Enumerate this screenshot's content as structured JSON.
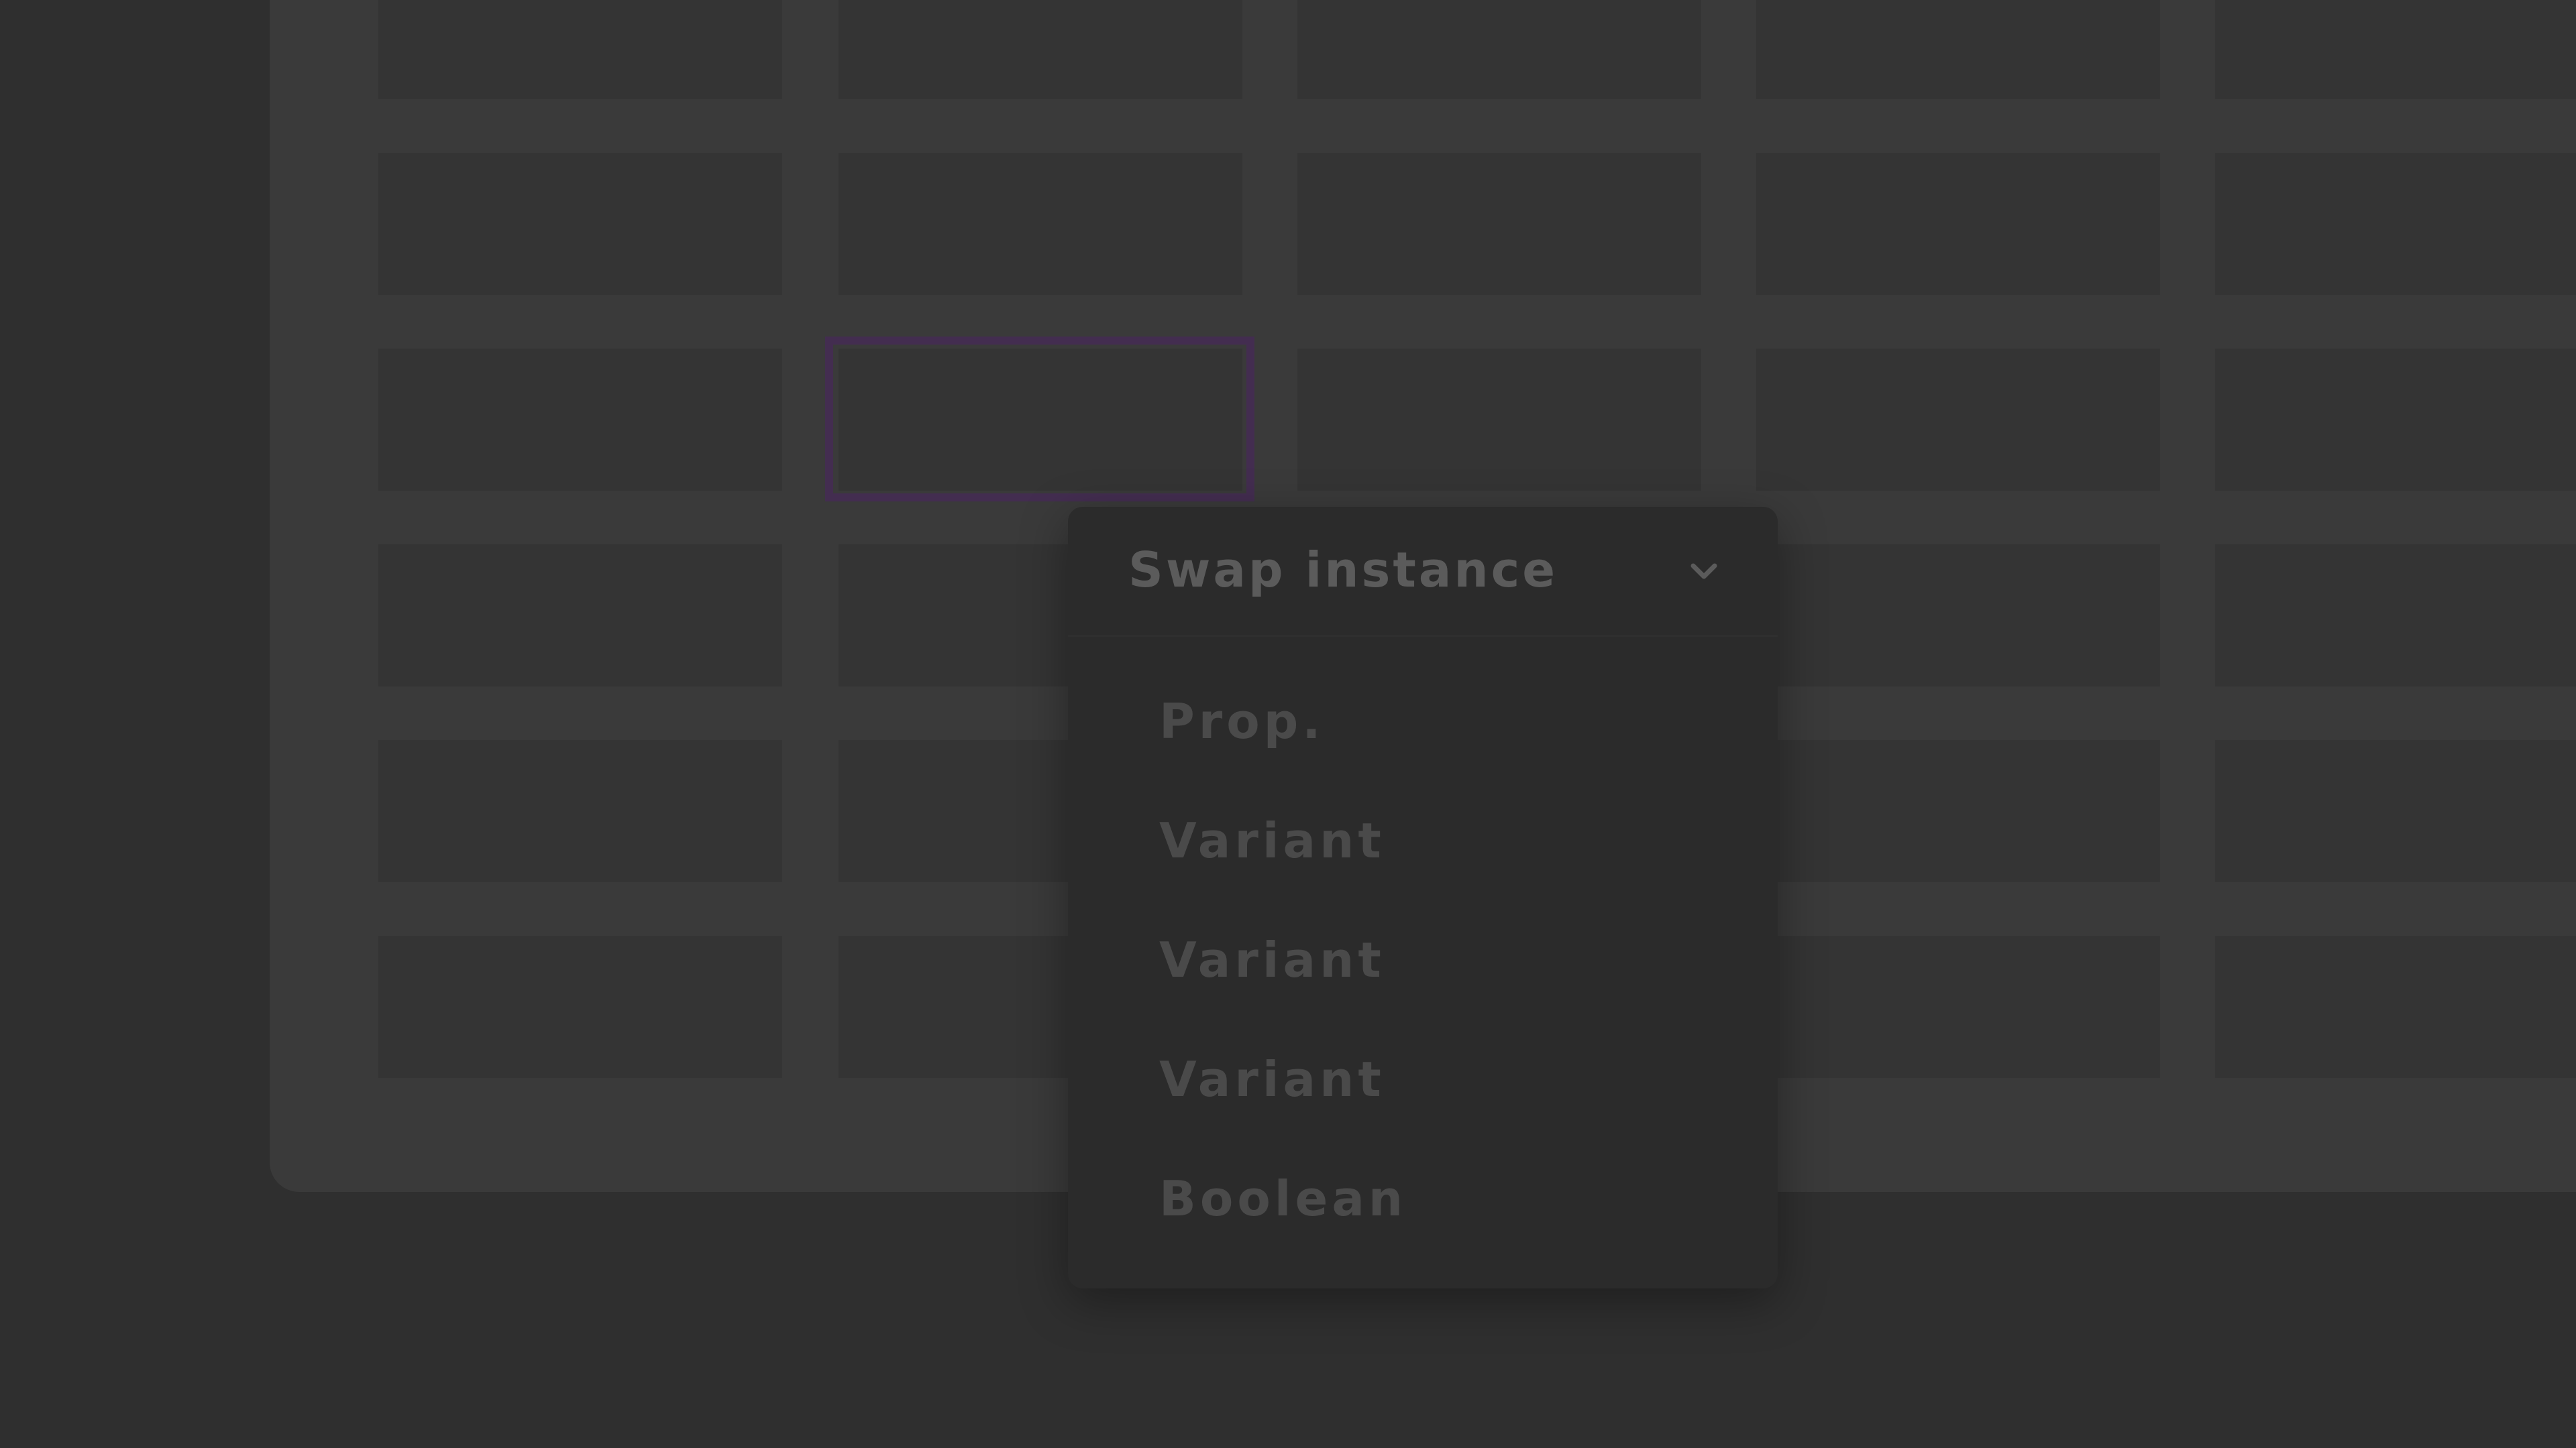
{
  "dropdown": {
    "title": "Swap instance",
    "toggle_icon": "chevron-down-icon",
    "items": [
      {
        "label": "Prop."
      },
      {
        "label": "Variant"
      },
      {
        "label": "Variant"
      },
      {
        "label": "Variant"
      },
      {
        "label": "Boolean"
      }
    ]
  },
  "colors": {
    "background": "#2f2f2f",
    "panel": "#3a3a3a",
    "cell": "#343434",
    "selection_outline": "#432d50",
    "menu": "#2b2b2b",
    "menu_text": "#4a4a4a",
    "title_text": "#5b5b5b"
  }
}
